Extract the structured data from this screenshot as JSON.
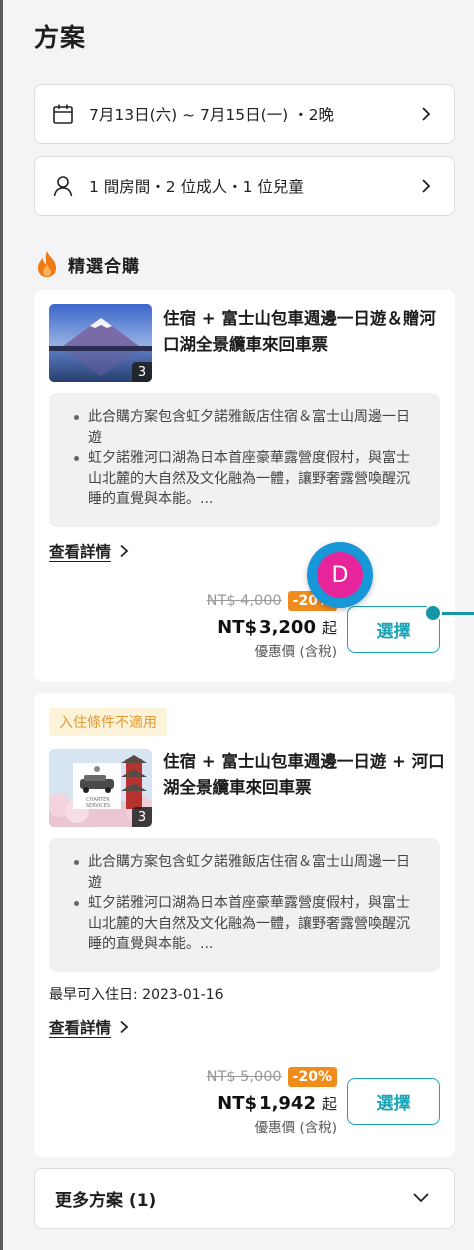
{
  "page": {
    "title": "方案"
  },
  "date_selector": {
    "text": "7月13日(六) ~ 7月15日(一) ・2晚",
    "icon": "calendar-icon"
  },
  "guest_selector": {
    "text": "1 間房間・2 位成人・1 位兒童",
    "icon": "person-icon"
  },
  "section": {
    "title": "精選合購",
    "icon": "flame-icon",
    "accent": "#f07b16"
  },
  "offers": [
    {
      "title": "住宿 + 富士山包車週邊一日遊＆贈河口湖全景纜車來回車票",
      "image_count": "3",
      "bullets": [
        "此合購方案包含虹夕諾雅飯店住宿＆富士山周邊一日遊",
        "虹夕諾雅河口湖為日本首座豪華露營度假村，與富士山北麓的大自然及文化融為一體，讓野奢露營喚醒沉睡的直覺與本能。..."
      ],
      "details_label": "查看詳情",
      "old_price": "NT$ 4,000",
      "discount": "-20%",
      "price_currency": "NT$",
      "price_amount": "3,200",
      "price_suffix": "起",
      "price_note": "優惠價 (含稅)",
      "select_label": "選擇"
    },
    {
      "badge": "入住條件不適用",
      "title": "住宿 + 富士山包車週邊一日遊 + 河口湖全景纜車來回車票",
      "image_count": "3",
      "image_caption": "CHARTER SERVICES",
      "bullets": [
        "此合購方案包含虹夕諾雅飯店住宿＆富士山周邊一日遊",
        "虹夕諾雅河口湖為日本首座豪華露營度假村，與富士山北麓的大自然及文化融為一體，讓野奢露營喚醒沉睡的直覺與本能。..."
      ],
      "earliest": "最早可入住日: 2023-01-16",
      "details_label": "查看詳情",
      "old_price": "NT$ 5,000",
      "discount": "-20%",
      "price_currency": "NT$",
      "price_amount": "1,942",
      "price_suffix": "起",
      "price_note": "優惠價 (含稅)",
      "select_label": "選擇"
    }
  ],
  "more_plans": {
    "label": "更多方案 (1)"
  },
  "avatar": {
    "letter": "D"
  },
  "colors": {
    "teal": "#1aa3b4",
    "discount": "#f08c1c",
    "badge_bg": "#fdf3d9",
    "badge_fg": "#e39a33"
  }
}
